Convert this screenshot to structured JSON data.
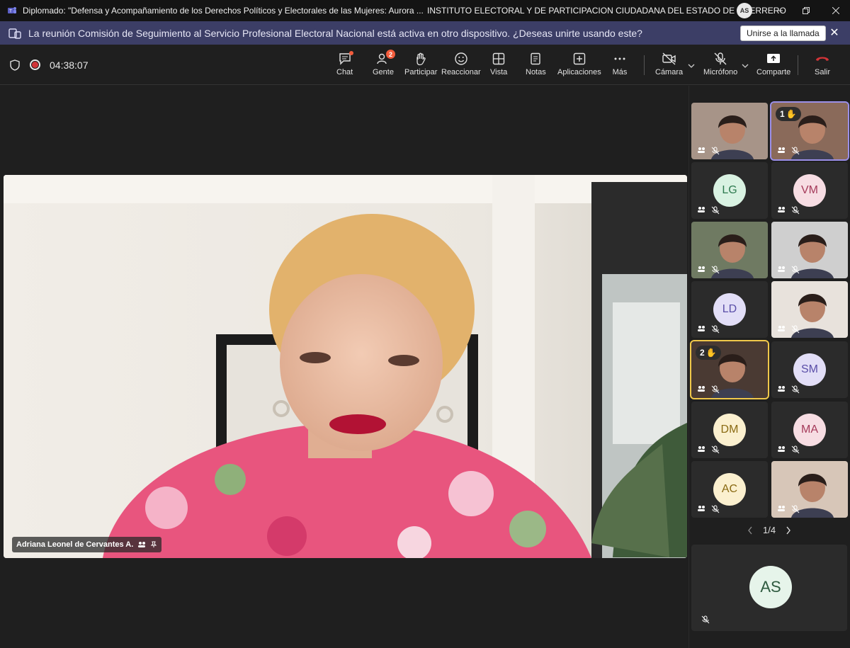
{
  "titlebar": {
    "title": "Diplomado: \"Defensa y Acompañamiento de los Derechos Políticos y Electorales de las Mujeres: Aurora ...",
    "org": "INSTITUTO ELECTORAL Y DE PARTICIPACION CIUDADANA DEL ESTADO DE GUERRERO",
    "avatar": "AS"
  },
  "banner": {
    "text": "La reunión Comisión de Seguimiento al Servicio Profesional Electoral Nacional está activa en otro dispositivo. ¿Deseas unirte usando este?",
    "join_label": "Unirse a la llamada",
    "close": "✕"
  },
  "toolbar": {
    "timer": "04:38:07",
    "buttons": {
      "chat": "Chat",
      "people": "Gente",
      "people_badge": "2",
      "raise": "Participar",
      "react": "Reaccionar",
      "view": "Vista",
      "notes": "Notas",
      "apps": "Aplicaciones",
      "more": "Más",
      "camera": "Cámara",
      "mic": "Micrófono",
      "share": "Comparte",
      "leave": "Salir"
    },
    "colors": {
      "leave": "#d13438",
      "badge": "#f25c3c"
    }
  },
  "stage": {
    "speaker_name": "Adriana Leonel de Cervantes A."
  },
  "gallery": {
    "tiles": [
      {
        "type": "video"
      },
      {
        "type": "video",
        "hand": "1"
      },
      {
        "type": "initials",
        "initials": "LG",
        "bg": "#d9f2e2",
        "fg": "#2e7a4f"
      },
      {
        "type": "initials",
        "initials": "VM",
        "bg": "#f7dde3",
        "fg": "#a53a5a"
      },
      {
        "type": "video"
      },
      {
        "type": "video"
      },
      {
        "type": "initials",
        "initials": "LD",
        "bg": "#e2def7",
        "fg": "#5a4ea8"
      },
      {
        "type": "video"
      },
      {
        "type": "video",
        "hand": "2"
      },
      {
        "type": "initials",
        "initials": "SM",
        "bg": "#e2def7",
        "fg": "#5a4ea8"
      },
      {
        "type": "initials",
        "initials": "DM",
        "bg": "#fbf0cf",
        "fg": "#8a6a12"
      },
      {
        "type": "initials",
        "initials": "MA",
        "bg": "#f7dde3",
        "fg": "#a53a5a"
      },
      {
        "type": "initials",
        "initials": "AC",
        "bg": "#fbf0cf",
        "fg": "#8a6a12"
      },
      {
        "type": "video"
      }
    ],
    "pager": "1/4",
    "self": {
      "initials": "AS",
      "bg": "#e6f4ea",
      "fg": "#2e5a3f"
    }
  }
}
